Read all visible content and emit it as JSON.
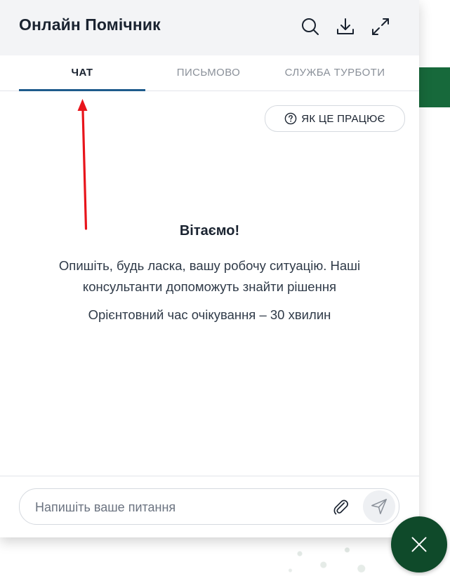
{
  "widget": {
    "title": "Онлайн Помічник",
    "tabs": [
      {
        "label": "ЧАТ",
        "active": true
      },
      {
        "label": "ПИСЬМОВО",
        "active": false
      },
      {
        "label": "СЛУЖБА ТУРБОТИ",
        "active": false
      }
    ],
    "how_it_works_label": "ЯК ЦЕ ПРАЦЮЄ",
    "welcome_title": "Вітаємо!",
    "welcome_text": "Опишіть, будь ласка, вашу робочу ситуацію. Наші консультанти допоможуть знайти рішення",
    "wait_text": "Орієнтовний час очікування – 30 хвилин",
    "input_placeholder": "Напишіть ваше питання"
  },
  "icons": [
    "search-icon",
    "download-icon",
    "expand-icon",
    "help-circle-icon",
    "paperclip-icon",
    "send-icon",
    "close-icon"
  ],
  "colors": {
    "header_bg": "#f3f4f6",
    "active_tab_underline": "#1e5b8c",
    "fab_bg": "#0f4a2a",
    "annotation_arrow": "#e8141b",
    "page_accent": "#17693b"
  }
}
